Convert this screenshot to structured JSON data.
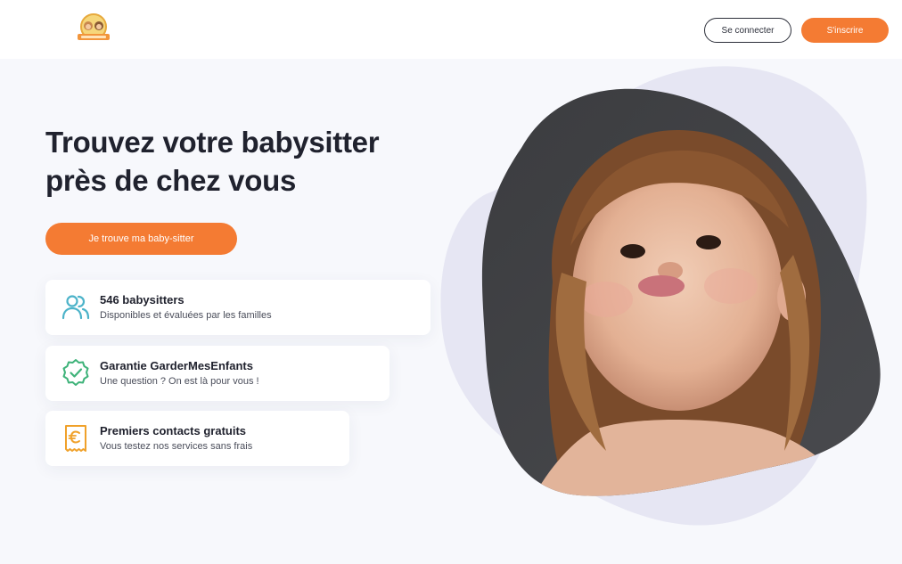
{
  "header": {
    "logo_name": "logo-gardermesenfants",
    "login_label": "Se connecter",
    "signup_label": "S'inscrire"
  },
  "hero": {
    "title_line1": "Trouvez votre babysitter",
    "title_line2": "près de chez vous",
    "cta_label": "Je trouve ma baby-sitter"
  },
  "features": [
    {
      "icon": "users-icon",
      "title": "546 babysitters",
      "subtitle": "Disponibles et évaluées par les familles"
    },
    {
      "icon": "badge-check-icon",
      "title": "Garantie GarderMesEnfants",
      "subtitle": "Une question ? On est là pour vous !"
    },
    {
      "icon": "euro-ticket-icon",
      "title": "Premiers contacts gratuits",
      "subtitle": "Vous testez nos services sans frais"
    }
  ],
  "colors": {
    "accent": "#f47b33",
    "teal_icon": "#4cb3c9",
    "green_icon": "#3fb37a",
    "orange_icon": "#f0a12a",
    "blob_back": "#e6e6f3",
    "blob_photo": "#3c3d40"
  }
}
